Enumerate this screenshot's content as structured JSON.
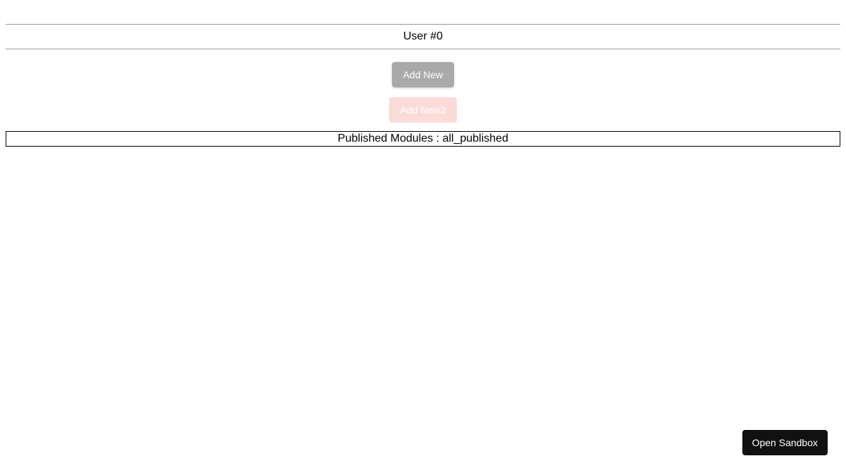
{
  "header": {
    "user_label": "User #0"
  },
  "buttons": {
    "add_new_label": "Add New",
    "add_new2_label": "Add New2"
  },
  "modules": {
    "published_label": "Published Modules : all_published"
  },
  "footer": {
    "open_sandbox_label": "Open Sandbox"
  }
}
